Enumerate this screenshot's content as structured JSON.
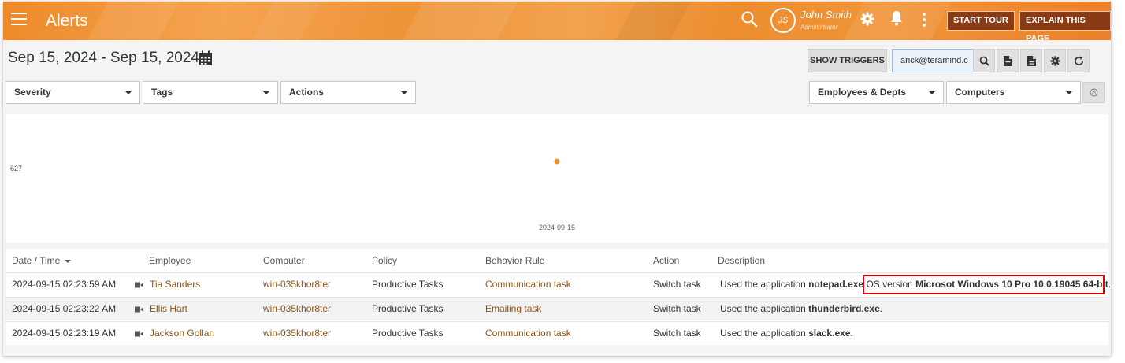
{
  "header": {
    "title": "Alerts",
    "avatar_initials": "JS",
    "user_name": "John Smith",
    "user_role": "Administrator",
    "start_tour": "START TOUR",
    "explain": "EXPLAIN THIS PAGE",
    "icons": [
      "menu-icon",
      "search-icon",
      "gear-icon",
      "bell-icon",
      "more-vertical-icon"
    ]
  },
  "toolbar": {
    "date_range": "Sep 15, 2024 - Sep 15, 2024",
    "show_triggers": "SHOW TRIGGERS",
    "email": "arick@teramind.c",
    "icons": [
      "calendar-icon",
      "search-icon",
      "pdf-icon",
      "csv-icon",
      "gear-icon",
      "refresh-icon"
    ]
  },
  "filters": {
    "severity": "Severity",
    "tags": "Tags",
    "actions": "Actions",
    "employees": "Employees & Depts",
    "computers": "Computers"
  },
  "chart_data": {
    "type": "scatter",
    "x": [
      "2024-09-15"
    ],
    "y": [
      627
    ],
    "ytick": "627",
    "xtick": "2024-09-15",
    "color": "#f0932b"
  },
  "table": {
    "columns": [
      "Date / Time",
      "Employee",
      "Computer",
      "Policy",
      "Behavior Rule",
      "Action",
      "Description"
    ],
    "rows": [
      {
        "datetime": "2024-09-15 02:23:59 AM",
        "employee": "Tia Sanders",
        "computer": "win-035khor8ter",
        "policy": "Productive Tasks",
        "rule": "Communication task",
        "action": "Switch task",
        "desc_prefix": "Used the application ",
        "desc_bold": "notepad.exe",
        "desc_os_label": "OS version ",
        "desc_os_bold": "Microsot Windows 10 Pro 10.0.19045 64-bit",
        "desc_suffix": "."
      },
      {
        "datetime": "2024-09-15 02:23:22 AM",
        "employee": "Ellis Hart",
        "computer": "win-035khor8ter",
        "policy": "Productive Tasks",
        "rule": "Emailing task",
        "action": "Switch task",
        "desc_prefix": "Used the application ",
        "desc_bold": "thunderbird.exe",
        "desc_suffix": "."
      },
      {
        "datetime": "2024-09-15 02:23:19 AM",
        "employee": "Jackson Gollan",
        "computer": "win-035khor8ter",
        "policy": "Productive Tasks",
        "rule": "Communication task",
        "action": "Switch task",
        "desc_prefix": "Used the application ",
        "desc_bold": "slack.exe",
        "desc_suffix": "."
      }
    ]
  }
}
